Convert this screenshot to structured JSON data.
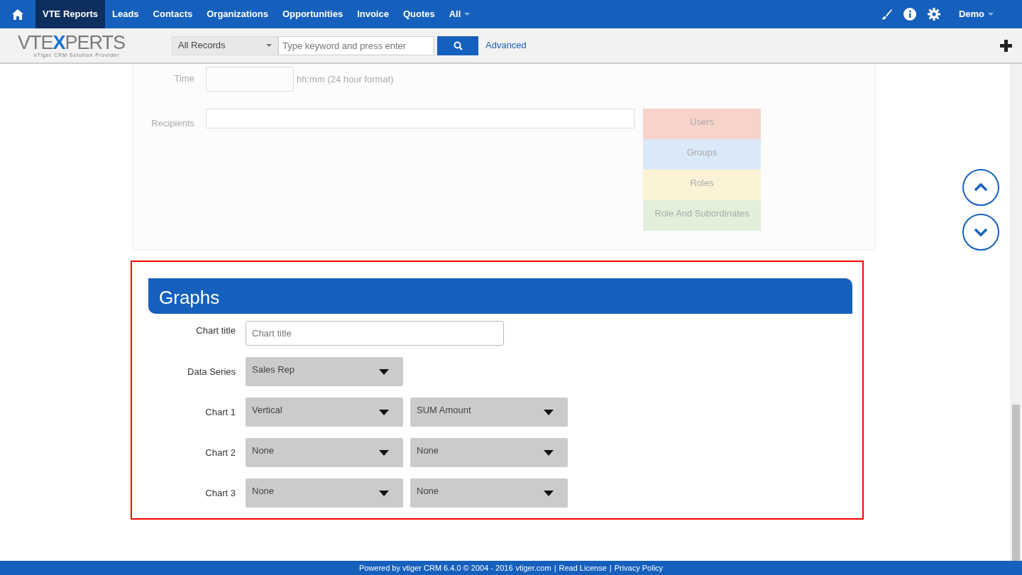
{
  "nav": {
    "items": [
      {
        "label": "VTE Reports",
        "selected": true
      },
      {
        "label": "Leads",
        "selected": false
      },
      {
        "label": "Contacts",
        "selected": false
      },
      {
        "label": "Organizations",
        "selected": false
      },
      {
        "label": "Opportunities",
        "selected": false
      },
      {
        "label": "Invoice",
        "selected": false
      },
      {
        "label": "Quotes",
        "selected": false
      }
    ],
    "more": "All",
    "user": "Demo"
  },
  "logo": {
    "segments": [
      {
        "text": "VTE",
        "color": "#7a7a7a"
      },
      {
        "text": "X",
        "color": "#1a6fd0"
      },
      {
        "text": "PERTS",
        "color": "#7a7a7a"
      }
    ],
    "tagline": "vTiger  CRM Solution Provider"
  },
  "search": {
    "scope": "All Records",
    "placeholder": "Type keyword and press enter",
    "advanced": "Advanced"
  },
  "schedule": {
    "time_label": "Time",
    "time_hint": "hh:mm (24 hour format)",
    "recipients_label": "Recipients",
    "recipient_types": [
      {
        "label": "Users",
        "color": "#f8d3ca"
      },
      {
        "label": "Groups",
        "color": "#dae9f8"
      },
      {
        "label": "Roles",
        "color": "#fcf3d6"
      },
      {
        "label": "Role And Subordinates",
        "color": "#e2efda"
      }
    ]
  },
  "graphs": {
    "title": "Graphs",
    "chart_title_label": "Chart title",
    "chart_title_placeholder": "Chart title",
    "rows": [
      {
        "label": "Data Series",
        "selects": [
          "Sales Rep"
        ]
      },
      {
        "label": "Chart 1",
        "selects": [
          "Vertical",
          "SUM Amount"
        ]
      },
      {
        "label": "Chart 2",
        "selects": [
          "None",
          "None"
        ]
      },
      {
        "label": "Chart 3",
        "selects": [
          "None",
          "None"
        ]
      }
    ]
  },
  "footer": {
    "text": "Powered by vtiger CRM 6.4.0  © 2004 - 2016",
    "separator": "|",
    "links": [
      "vtiger.com",
      "Read License",
      "Privacy Policy"
    ]
  }
}
